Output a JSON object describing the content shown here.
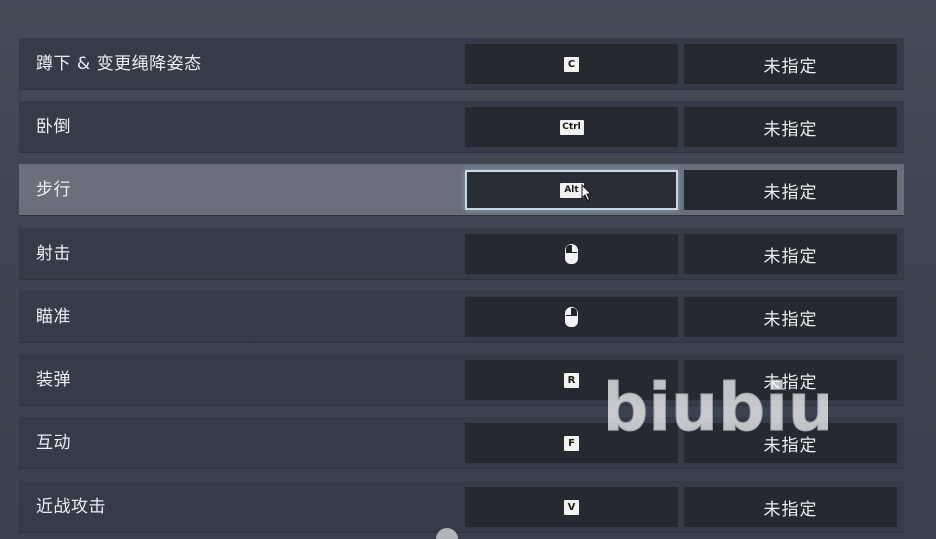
{
  "rows": [
    {
      "label": "蹲下 & 变更绳降姿态",
      "key": "C",
      "key_type": "keycap",
      "alt": "未指定"
    },
    {
      "label": "卧倒",
      "key": "Ctrl",
      "key_type": "keycap",
      "alt": "未指定"
    },
    {
      "label": "步行",
      "key": "Alt",
      "key_type": "keycap",
      "alt": "未指定",
      "selected": true
    },
    {
      "label": "射击",
      "key": "mouse-left-icon",
      "key_type": "mouse",
      "alt": "未指定"
    },
    {
      "label": "瞄准",
      "key": "mouse-right-icon",
      "key_type": "mouse",
      "alt": "未指定"
    },
    {
      "label": "装弹",
      "key": "R",
      "key_type": "keycap",
      "alt": "未指定"
    },
    {
      "label": "互动",
      "key": "F",
      "key_type": "keycap",
      "alt": "未指定"
    },
    {
      "label": "近战攻击",
      "key": "V",
      "key_type": "keycap",
      "alt": "未指定"
    }
  ],
  "watermark": "biubiu",
  "colors": {
    "row_bg": "#363c47",
    "row_selected_bg": "#6a6f79",
    "cell_bg": "#26292f",
    "focus_border": "#c9d6e4",
    "text": "#eceef1"
  }
}
